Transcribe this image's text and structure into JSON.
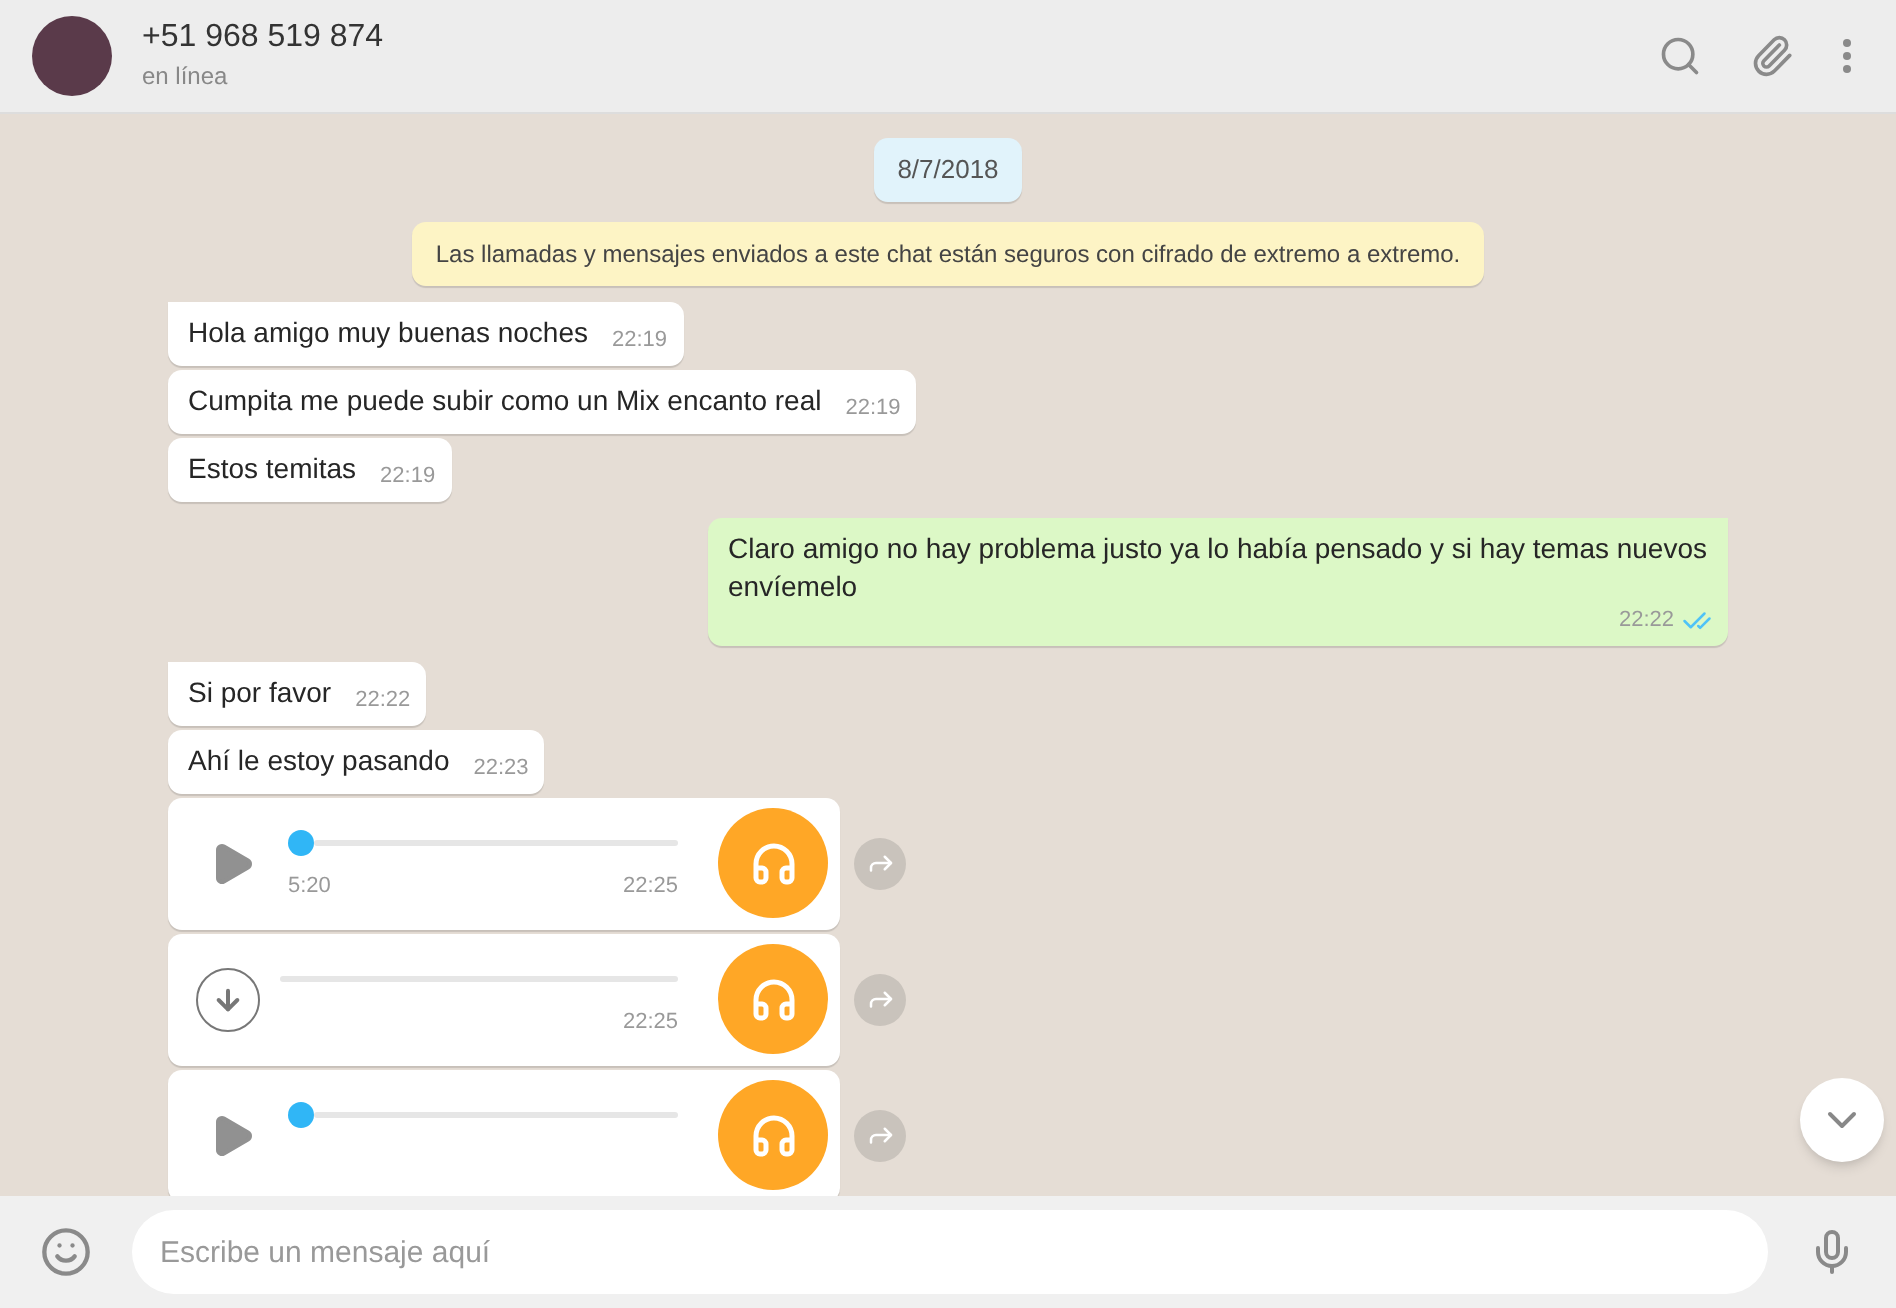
{
  "header": {
    "name": "+51 968 519 874",
    "status": "en línea"
  },
  "messages": [
    {
      "kind": "date",
      "text": "8/7/2018"
    },
    {
      "kind": "system",
      "text": "Las llamadas y mensajes enviados a este chat están seguros con cifrado de extremo a extremo."
    },
    {
      "kind": "text",
      "outgoing": false,
      "text": "Hola amigo muy buenas noches",
      "time": "22:19",
      "tail": true
    },
    {
      "kind": "text",
      "outgoing": false,
      "text": "Cumpita me puede subir como un Mix encanto real",
      "time": "22:19",
      "tail": false
    },
    {
      "kind": "text",
      "outgoing": false,
      "text": "Estos temitas",
      "time": "22:19",
      "tail": false
    },
    {
      "kind": "text",
      "outgoing": true,
      "text": "Claro amigo no hay problema justo ya lo había pensado y si hay temas nuevos envíemelo",
      "time": "22:22",
      "tail": true,
      "read": true
    },
    {
      "kind": "text",
      "outgoing": false,
      "text": "Si por favor",
      "time": "22:22",
      "tail": true
    },
    {
      "kind": "text",
      "outgoing": false,
      "text": "Ahí le estoy pasando",
      "time": "22:23",
      "tail": false
    },
    {
      "kind": "audio",
      "downloaded": true,
      "level": 0,
      "duration": "5:20",
      "time": "22:25"
    },
    {
      "kind": "audio",
      "downloaded": false,
      "time": "22:25"
    },
    {
      "kind": "audio",
      "downloaded": true,
      "level": 0
    }
  ],
  "composer": {
    "placeholder": "Escribe un mensaje aquí"
  }
}
